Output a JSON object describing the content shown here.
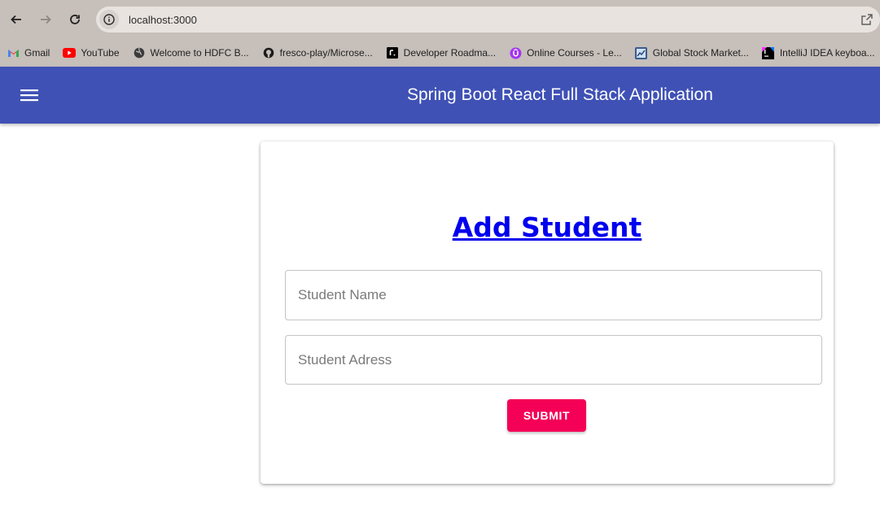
{
  "browser": {
    "url": "localhost:3000",
    "bookmarks": [
      {
        "label": "Gmail",
        "icon": "gmail-icon"
      },
      {
        "label": "YouTube",
        "icon": "youtube-icon"
      },
      {
        "label": "Welcome to HDFC B...",
        "icon": "globe-icon"
      },
      {
        "label": "fresco-play/Microse...",
        "icon": "github-icon"
      },
      {
        "label": "Developer Roadma...",
        "icon": "roadmap-icon"
      },
      {
        "label": "Online Courses - Le...",
        "icon": "courses-icon"
      },
      {
        "label": "Global Stock Market...",
        "icon": "stock-icon"
      },
      {
        "label": "IntelliJ IDEA keyboa...",
        "icon": "intellij-icon"
      }
    ]
  },
  "app_bar": {
    "title": "Spring Boot React Full Stack Application",
    "menu_icon": "menu-icon",
    "color": "#3f51b5"
  },
  "form": {
    "heading": "Add Student",
    "name_field": {
      "placeholder": "Student Name",
      "value": ""
    },
    "address_field": {
      "placeholder": "Student Adress",
      "value": ""
    },
    "submit_label": "SUBMIT",
    "submit_color": "#f50057",
    "heading_color": "#0000ee"
  }
}
